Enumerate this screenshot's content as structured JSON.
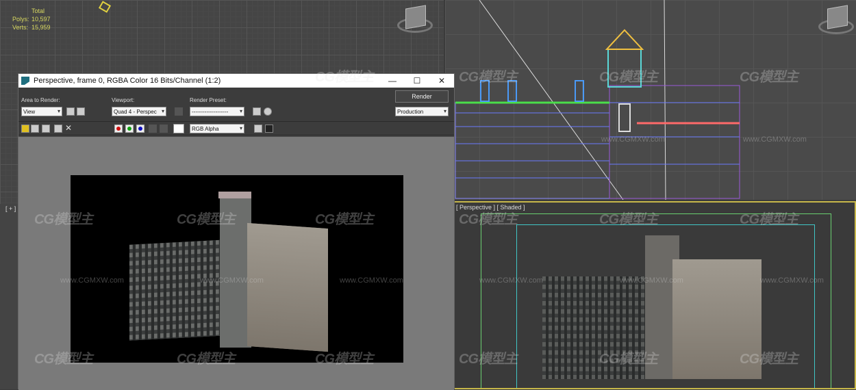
{
  "viewport_tl": {
    "stats": {
      "title": "Total",
      "polys_label": "Polys:",
      "polys_value": "10,597",
      "verts_label": "Verts:",
      "verts_value": "15,959"
    },
    "corner_label": "[ + ]"
  },
  "viewport_br": {
    "label": "[ Perspective ] [ Shaded ]"
  },
  "render_window": {
    "title": "Perspective, frame 0, RGBA Color 16 Bits/Channel (1:2)",
    "minimize": "—",
    "maximize": "☐",
    "close": "✕",
    "area_to_render_label": "Area to Render:",
    "area_to_render_value": "View",
    "viewport_label": "Viewport:",
    "viewport_value": "Quad 4 - Perspec",
    "render_preset_label": "Render Preset:",
    "render_preset_value": "--------------------",
    "render_button": "Render",
    "production_value": "Production",
    "channel_value": "RGB Alpha",
    "colors": {
      "red": "#d01010",
      "green": "#10a010",
      "blue": "#1010c0"
    }
  },
  "watermarks": {
    "logo": "CG模型主",
    "url": "www.CGMXW.com"
  }
}
